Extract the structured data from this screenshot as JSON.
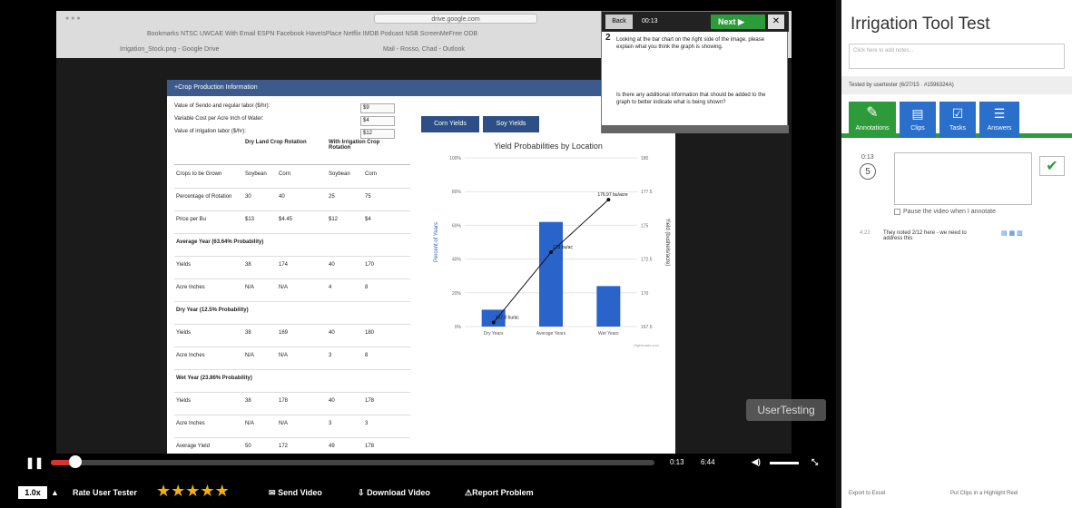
{
  "browser": {
    "address": "drive.google.com",
    "bookmarks": "Bookmarks  NTSC  UWCAE  With Email  ESPN  Facebook  HaveIsPlace  Netflix  IMDB  Podcast  NSB  ScreenMeFree  ODB",
    "tab_left": "Irrigation_Stock.png - Google Drive",
    "tab_right": "Mail - Rosso, Chad - Outlook"
  },
  "form": {
    "panel_title": "+Crop Production Information",
    "fields": [
      {
        "label": "Value of Sendo and regular labor ($/hr):",
        "value": "$9"
      },
      {
        "label": "Variable Cost per Acre Inch of Water:",
        "value": "$4"
      },
      {
        "label": "Value of irrigation labor ($/hr):",
        "value": "$12"
      }
    ],
    "col_dry": "Dry Land Crop Rotation",
    "col_irr": "With Irrigation Crop Rotation",
    "rows": [
      {
        "label": "Crops to be Grown",
        "c": [
          "Soybean",
          "Corn",
          "Soybean",
          "Corn"
        ]
      },
      {
        "label": "Percentage of Rotation",
        "c": [
          "30",
          "40",
          "25",
          "75"
        ]
      },
      {
        "label": "Price per Bu",
        "c": [
          "$13",
          "$4.45",
          "$12",
          "$4"
        ]
      },
      {
        "label": "Average Year (63.64% Probability)",
        "section": true
      },
      {
        "label": "Yields",
        "c": [
          "38",
          "174",
          "40",
          "170"
        ]
      },
      {
        "label": "Acre Inches",
        "c": [
          "N/A",
          "N/A",
          "4",
          "8"
        ]
      },
      {
        "label": "Dry Year (12.5% Probability)",
        "section": true
      },
      {
        "label": "Yields",
        "c": [
          "38",
          "169",
          "40",
          "180"
        ]
      },
      {
        "label": "Acre Inches",
        "c": [
          "N/A",
          "N/A",
          "3",
          "8"
        ]
      },
      {
        "label": "Wet Year (23.86% Probability)",
        "section": true
      },
      {
        "label": "Yields",
        "c": [
          "38",
          "178",
          "40",
          "178"
        ]
      },
      {
        "label": "Acre Inches",
        "c": [
          "N/A",
          "N/A",
          "3",
          "3"
        ]
      },
      {
        "label": "Average Yield",
        "c": [
          "50",
          "172",
          "49",
          "178"
        ]
      }
    ]
  },
  "chart_tabs": {
    "corn": "Corn Yields",
    "soy": "Soy Yields"
  },
  "chart_data": {
    "type": "bar",
    "title": "Yield Probabilities by Location",
    "categories": [
      "Dry Years",
      "Average Years",
      "Wet Years"
    ],
    "values": [
      10,
      62,
      24
    ],
    "line_values": [
      167.8,
      173,
      176.9
    ],
    "line_labels": [
      "167.8 bu/ac",
      "173 bu/ac",
      "176.97 bu/acre"
    ],
    "ylabel": "Percent of Years",
    "y2label": "Yield (bushels/acre)",
    "ylim": [
      0,
      100
    ],
    "y2lim": [
      167.5,
      180
    ],
    "yticks": [
      "100%",
      "80%",
      "60%",
      "40%",
      "20%",
      "0%"
    ],
    "y2ticks": [
      "180",
      "177.5",
      "175",
      "172.5",
      "170",
      "167.5"
    ],
    "credit": "Highcharts.com"
  },
  "task": {
    "status": "Back",
    "time": "00:13",
    "next_label": "Next",
    "number": "2",
    "question1": "Looking at the bar chart on the right side of the image, please explain what you think the graph is showing.",
    "question2": "Is there any additional information that should be added to the graph to better indicate what is being shown?"
  },
  "player": {
    "time_current": "0:13",
    "time_total": "6:44",
    "progress": 0.04,
    "speed": "1.0x",
    "rate_label": "Rate User Tester",
    "stars": 5,
    "send_video": "Send Video",
    "download_video": "Download Video",
    "report_problem": "Report Problem",
    "watermark": "UserTesting"
  },
  "side": {
    "title": "Irrigation Tool Test",
    "note_placeholder": "Click here to add notes...",
    "tested_by": "Tested by usertester (6/27/15 · #1596324A)",
    "tabs": [
      "Annotations",
      "Clips",
      "Tasks",
      "Answers"
    ],
    "ann_time": "0:13",
    "ann_step": "5",
    "pause_label": "Pause the video when I annotate",
    "note_time": "4:22",
    "note_text": "They noted 2/12 here - we need to address this",
    "foot_left": "Export to Excel",
    "foot_right": "Put Clips in a Highlight Reel"
  },
  "colors": {
    "accent_green": "#2e9b3a",
    "bar_blue": "#2a63c9",
    "progress_red": "#d9352e"
  }
}
